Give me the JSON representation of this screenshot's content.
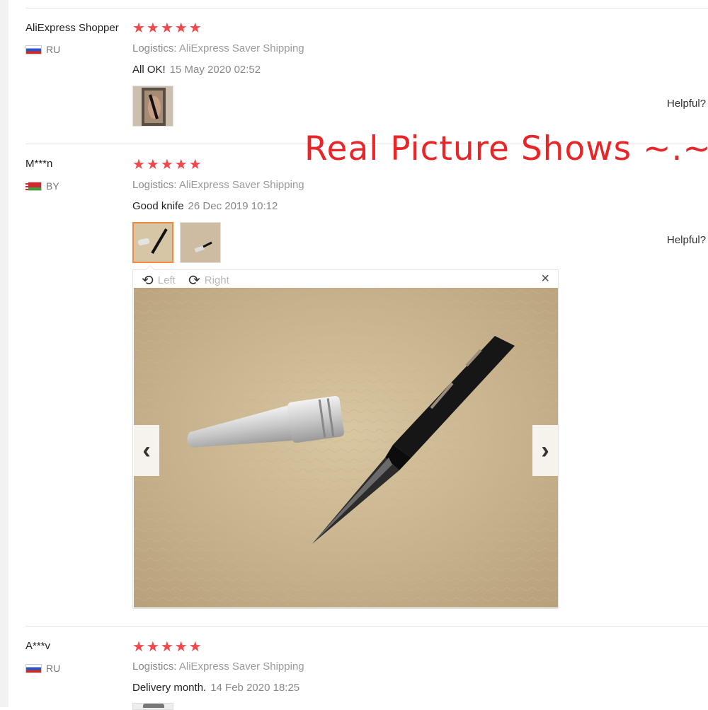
{
  "headline": "Real Picture Shows ~.~",
  "reviews": [
    {
      "user": "AliExpress Shopper",
      "country": "RU",
      "stars": "★★★★★",
      "logistics_label": "Logistics:",
      "logistics_value": "AliExpress Saver Shipping",
      "comment": "All OK!",
      "date": "15 May 2020 02:52",
      "helpful": "Helpful?"
    },
    {
      "user": "M***n",
      "country": "BY",
      "stars": "★★★★★",
      "logistics_label": "Logistics:",
      "logistics_value": "AliExpress Saver Shipping",
      "comment": "Good knife",
      "date": "26 Dec 2019 10:12",
      "helpful": "Helpful?"
    },
    {
      "user": "A***v",
      "country": "RU",
      "stars": "★★★★★",
      "logistics_label": "Logistics:",
      "logistics_value": "AliExpress Saver Shipping",
      "comment": "Delivery month.",
      "date": "14 Feb 2020 18:25"
    }
  ],
  "viewer": {
    "rotate_left": "Left",
    "rotate_right": "Right",
    "close": "×",
    "prev": "‹",
    "next": "›"
  },
  "icons": {
    "rotate_left": "⟲",
    "rotate_right": "⟳"
  }
}
